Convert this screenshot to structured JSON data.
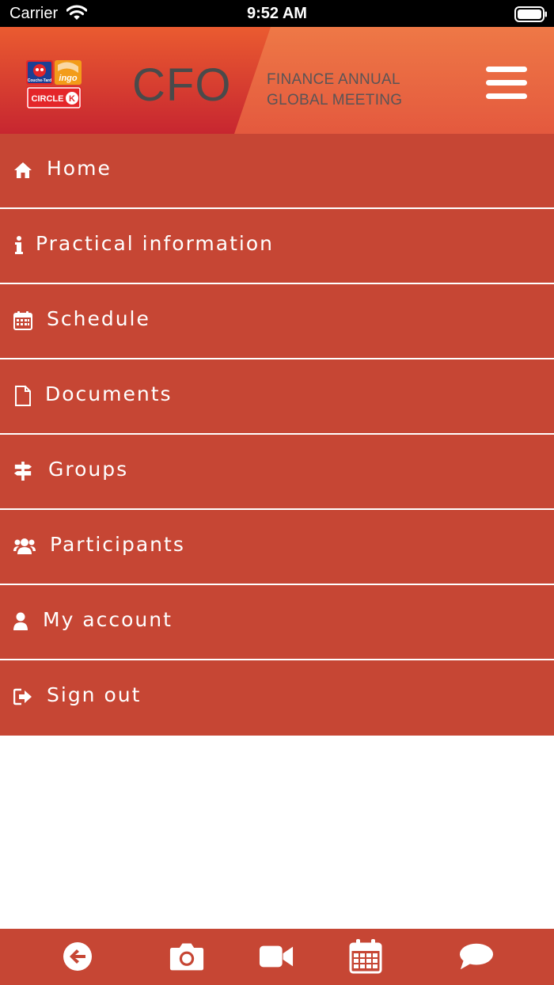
{
  "status_bar": {
    "carrier": "Carrier",
    "time": "9:52 AM"
  },
  "header": {
    "logo_text": "CIRCLE K",
    "logo_sub1": "Couche-Tard",
    "logo_sub2": "ingo",
    "title": "CFO",
    "subtitle_line1": "FINANCE ANNUAL",
    "subtitle_line2": "GLOBAL MEETING"
  },
  "menu": {
    "items": [
      {
        "label": "Home",
        "icon": "home-icon"
      },
      {
        "label": "Practical information",
        "icon": "info-icon"
      },
      {
        "label": "Schedule",
        "icon": "calendar-icon"
      },
      {
        "label": "Documents",
        "icon": "document-icon"
      },
      {
        "label": "Groups",
        "icon": "signpost-icon"
      },
      {
        "label": "Participants",
        "icon": "users-icon"
      },
      {
        "label": "My account",
        "icon": "user-icon"
      },
      {
        "label": "Sign out",
        "icon": "sign-out-icon"
      }
    ]
  },
  "bottom_bar": {
    "buttons": [
      "back-icon",
      "camera-icon",
      "video-icon",
      "calendar-icon",
      "chat-icon"
    ]
  },
  "colors": {
    "menu_bg": "#c64634",
    "header_top": "#ee7846",
    "header_accent": "#c8282e"
  }
}
